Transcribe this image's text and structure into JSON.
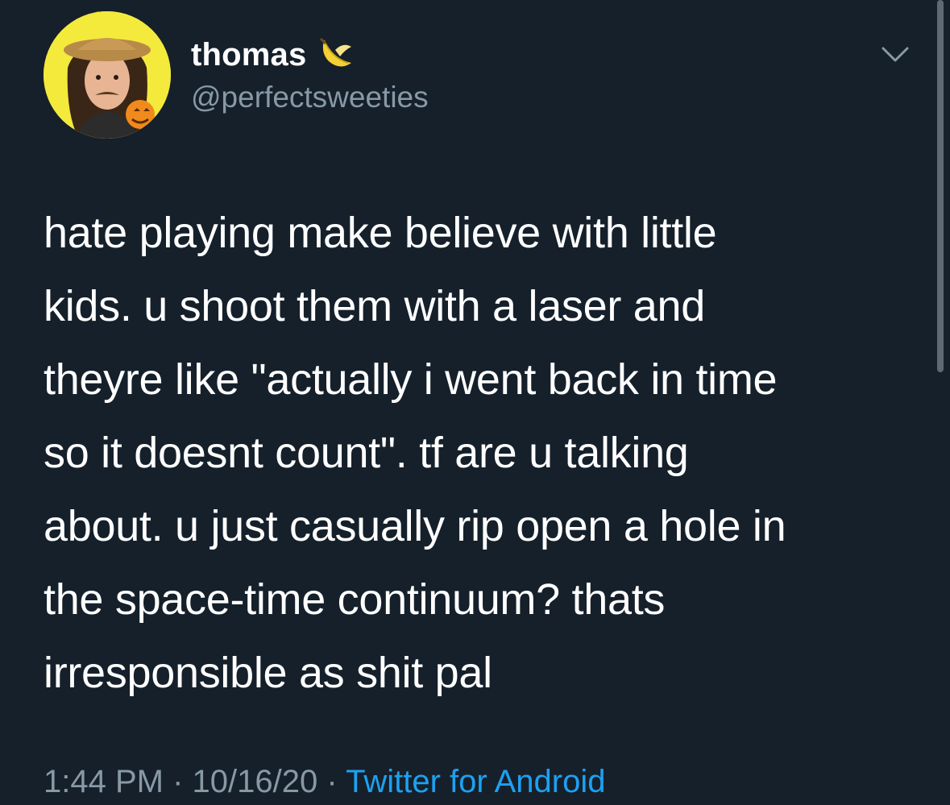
{
  "user": {
    "display_name": "thomas",
    "handle": "@perfectsweeties",
    "name_emoji": "banana-icon",
    "avatar": "avatar-photo"
  },
  "tweet": {
    "text": "hate playing make believe with little\nkids. u shoot them with a laser and\ntheyre like \"actually i went back in time\nso it doesnt count\". tf are u talking\nabout. u just casually rip open a hole in\nthe space-time continuum? thats\nirresponsible as shit pal",
    "time": "1:44 PM",
    "date": "10/16/20",
    "separator": "·",
    "source": "Twitter for Android"
  },
  "colors": {
    "background": "#15202b",
    "text": "#ffffff",
    "secondary": "#8899a6",
    "link": "#1da1f2"
  },
  "icons": {
    "menu": "chevron-down-icon"
  }
}
